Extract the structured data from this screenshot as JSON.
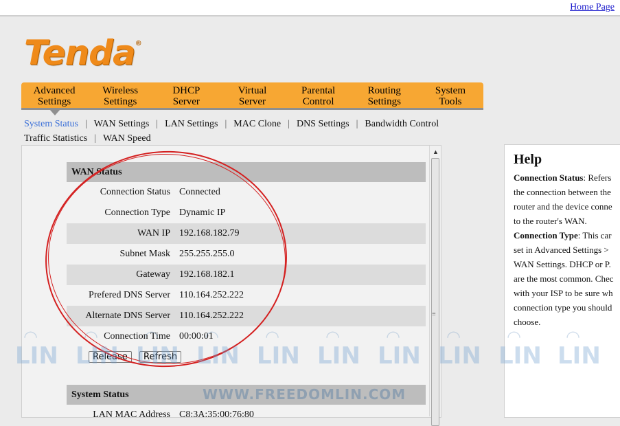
{
  "header": {
    "home_link": "Home Page"
  },
  "logo": {
    "text": "Tenda",
    "reg": "®"
  },
  "main_nav": [
    {
      "line1": "Advanced",
      "line2": "Settings"
    },
    {
      "line1": "Wireless",
      "line2": "Settings"
    },
    {
      "line1": "DHCP",
      "line2": "Server"
    },
    {
      "line1": "Virtual",
      "line2": "Server"
    },
    {
      "line1": "Parental",
      "line2": "Control"
    },
    {
      "line1": "Routing",
      "line2": "Settings"
    },
    {
      "line1": "System",
      "line2": "Tools"
    }
  ],
  "sub_nav": {
    "items": [
      "System Status",
      "WAN Settings",
      "LAN Settings",
      "MAC Clone",
      "DNS Settings",
      "Bandwidth Control",
      "Traffic Statistics",
      "WAN Speed"
    ],
    "separator": "|"
  },
  "wan_status": {
    "title": "WAN Status",
    "rows": [
      {
        "label": "Connection Status",
        "value": "Connected"
      },
      {
        "label": "Connection Type",
        "value": "Dynamic IP"
      },
      {
        "label": "WAN IP",
        "value": "192.168.182.79"
      },
      {
        "label": "Subnet Mask",
        "value": "255.255.255.0"
      },
      {
        "label": "Gateway",
        "value": "192.168.182.1"
      },
      {
        "label": "Prefered DNS Server",
        "value": "110.164.252.222"
      },
      {
        "label": "Alternate DNS Server",
        "value": "110.164.252.222"
      },
      {
        "label": "Connection Time",
        "value": "00:00:01"
      }
    ],
    "release_label": "Release",
    "refresh_label": "Refresh"
  },
  "system_status": {
    "title": "System Status",
    "rows": [
      {
        "label": "LAN MAC Address",
        "value": "C8:3A:35:00:76:80"
      }
    ]
  },
  "help": {
    "title": "Help",
    "p1_term": "Connection Status",
    "p1_text": ": Refers\nthe connection between the\nrouter and the device conne\nto the router's WAN.",
    "p2_term": "Connection Type",
    "p2_text": ": This car\nset in Advanced Settings >\nWAN Settings. DHCP or P.\nare the most common. Chec\nwith your ISP to be sure wh\nconnection type you should\nchoose."
  },
  "watermark": {
    "mark": "LIN",
    "url": "WWW.FREEDOMLIN.COM"
  },
  "colors": {
    "nav_orange": "#f7a733",
    "logo_orange": "#ef8a1a",
    "active_link": "#3a6fd8",
    "annotation_red": "#d42020"
  }
}
